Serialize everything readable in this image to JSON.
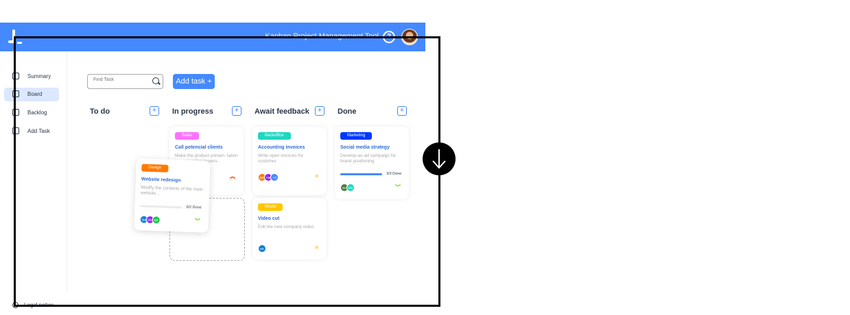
{
  "header": {
    "app_title": "Kanban Project Management Tool"
  },
  "sidebar": {
    "items": [
      {
        "label": "Summary",
        "active": false
      },
      {
        "label": "Board",
        "active": true
      },
      {
        "label": "Backlog",
        "active": false
      },
      {
        "label": "Add Task",
        "active": false
      }
    ],
    "legal": "Legal notice"
  },
  "toolbar": {
    "search_placeholder": "Find Task",
    "add_task_label": "Add task +"
  },
  "columns": [
    {
      "title": "To do"
    },
    {
      "title": "In progress"
    },
    {
      "title": "Await feedback"
    },
    {
      "title": "Done"
    }
  ],
  "cards": {
    "sales": {
      "tag": "Sales",
      "tag_color": "#FC71FF",
      "title": "Call potencial clients",
      "desc": "Make the product presen- tation to prospective buyers",
      "priority": "urgent"
    },
    "backoffice": {
      "tag": "Backoffice",
      "tag_color": "#1FD7C1",
      "title": "Accounting invoices",
      "desc": "Write open invoices for customer",
      "avatars": [
        "MB",
        "AM",
        "+3"
      ],
      "priority": "medium"
    },
    "marketing": {
      "tag": "Marketing",
      "tag_color": "#0038FF",
      "title": "Social media strategy",
      "desc": "Develop an ad campaign for brand positioning",
      "progress_text": "3/3 Done",
      "progress": 1.0,
      "avatars": [
        "BZ",
        "RS"
      ],
      "priority": "low"
    },
    "media": {
      "tag": "Media",
      "tag_color": "#FFC701",
      "title": "Video cut",
      "desc": "Edit the new company video",
      "avatars": [
        "HK"
      ],
      "priority": "medium"
    },
    "design": {
      "tag": "Design",
      "tag_color": "#FF7A00",
      "title": "Website redesign",
      "desc": "Modify the contents of the main website...",
      "progress_text": "0/2 Done",
      "progress": 0.0,
      "avatars": [
        "SM",
        "MV",
        "EF"
      ],
      "priority": "low"
    }
  },
  "colors": {
    "brand": "#4589FF",
    "urgent": "#FF3D00",
    "medium": "#FFA800",
    "low": "#7AE229"
  }
}
